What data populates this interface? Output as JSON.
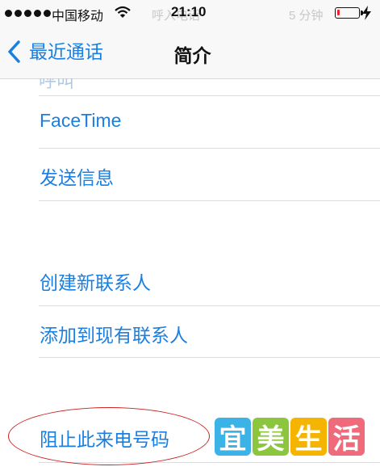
{
  "status_bar": {
    "carrier": "中国移动",
    "time": "21:10",
    "ghost_left": "呼入电话",
    "ghost_right": "5 分钟"
  },
  "nav": {
    "back_label": "最近通话",
    "title": "简介"
  },
  "list": {
    "cut_item": "呼叫",
    "items": [
      "FaceTime",
      "发送信息",
      "创建新联系人",
      "添加到现有联系人",
      "阻止此来电号码"
    ]
  },
  "watermark": {
    "chars": [
      "宜",
      "美",
      "生",
      "活"
    ],
    "colors": [
      "#3bb3e6",
      "#8cc63f",
      "#f4b400",
      "#ef6a7a"
    ]
  },
  "colors": {
    "accent": "#1a7fe0",
    "battery_low": "#e3262a",
    "annotation": "#cc2020"
  },
  "battery_level": 0.12,
  "icons": [
    "signal-dots-icon",
    "wifi-icon",
    "battery-icon",
    "charging-bolt-icon",
    "chevron-left-icon"
  ]
}
